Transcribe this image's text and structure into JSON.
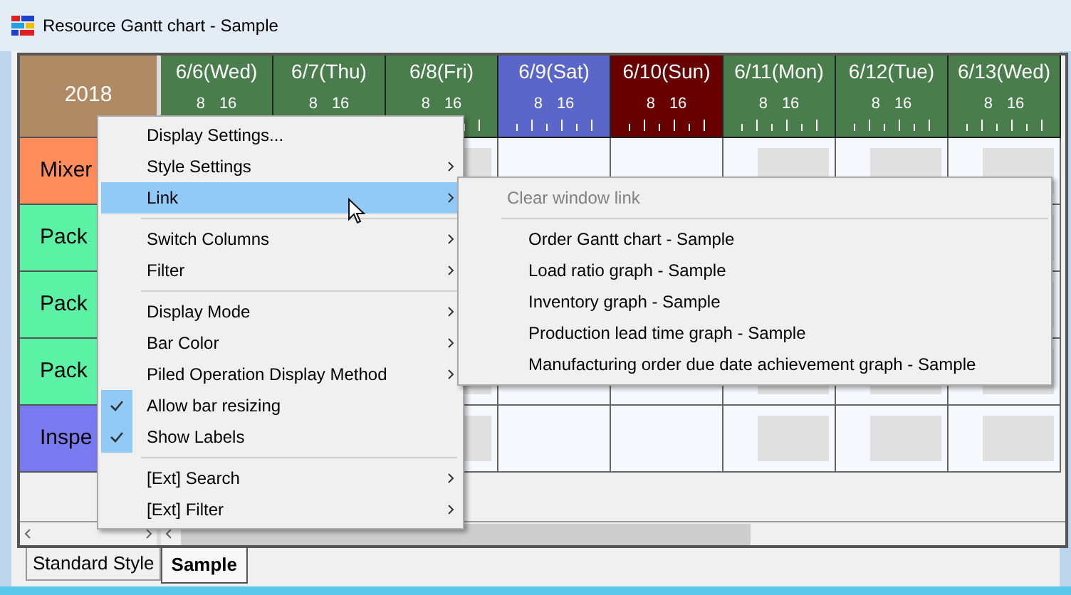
{
  "window": {
    "title": "Resource Gantt chart - Sample"
  },
  "year": "2018",
  "days": [
    {
      "label": "6/6(Wed)",
      "hours": [
        "8",
        "16"
      ],
      "kind": "weekday"
    },
    {
      "label": "6/7(Thu)",
      "hours": [
        "8",
        "16"
      ],
      "kind": "weekday"
    },
    {
      "label": "6/8(Fri)",
      "hours": [
        "8",
        "16"
      ],
      "kind": "weekday"
    },
    {
      "label": "6/9(Sat)",
      "hours": [
        "8",
        "16"
      ],
      "kind": "saturday"
    },
    {
      "label": "6/10(Sun)",
      "hours": [
        "8",
        "16"
      ],
      "kind": "sunday"
    },
    {
      "label": "6/11(Mon)",
      "hours": [
        "8",
        "16"
      ],
      "kind": "weekday"
    },
    {
      "label": "6/12(Tue)",
      "hours": [
        "8",
        "16"
      ],
      "kind": "weekday"
    },
    {
      "label": "6/13(Wed)",
      "hours": [
        "8",
        "16"
      ],
      "kind": "weekday"
    }
  ],
  "resources": [
    {
      "name": "Mixer",
      "color": "#ff8c5a"
    },
    {
      "name": "Pack",
      "color": "#5cf2a6"
    },
    {
      "name": "Pack",
      "color": "#5cf2a6"
    },
    {
      "name": "Pack",
      "color": "#5cf2a6"
    },
    {
      "name": "Inspe",
      "color": "#7a7af0"
    }
  ],
  "context_menu": {
    "items": [
      {
        "kind": "item",
        "label": "Display Settings...",
        "submenu": false,
        "checked": false,
        "selected": false
      },
      {
        "kind": "item",
        "label": "Style Settings",
        "submenu": true,
        "checked": false,
        "selected": false
      },
      {
        "kind": "item",
        "label": "Link",
        "submenu": true,
        "checked": false,
        "selected": true
      },
      {
        "kind": "separator"
      },
      {
        "kind": "item",
        "label": "Switch Columns",
        "submenu": true,
        "checked": false,
        "selected": false
      },
      {
        "kind": "item",
        "label": "Filter",
        "submenu": true,
        "checked": false,
        "selected": false
      },
      {
        "kind": "separator"
      },
      {
        "kind": "item",
        "label": "Display Mode",
        "submenu": true,
        "checked": false,
        "selected": false
      },
      {
        "kind": "item",
        "label": "Bar Color",
        "submenu": true,
        "checked": false,
        "selected": false
      },
      {
        "kind": "item",
        "label": "Piled Operation Display Method",
        "submenu": true,
        "checked": false,
        "selected": false
      },
      {
        "kind": "item",
        "label": "Allow bar resizing",
        "submenu": false,
        "checked": true,
        "selected": false
      },
      {
        "kind": "item",
        "label": "Show Labels",
        "submenu": false,
        "checked": true,
        "selected": false
      },
      {
        "kind": "separator"
      },
      {
        "kind": "item",
        "label": "[Ext] Search",
        "submenu": true,
        "checked": false,
        "selected": false
      },
      {
        "kind": "item",
        "label": "[Ext] Filter",
        "submenu": true,
        "checked": false,
        "selected": false
      }
    ]
  },
  "submenu": {
    "items": [
      {
        "kind": "item",
        "label": "Clear window link",
        "disabled": true
      },
      {
        "kind": "separator"
      },
      {
        "kind": "item",
        "label": "Order Gantt chart - Sample",
        "disabled": false
      },
      {
        "kind": "item",
        "label": "Load ratio graph - Sample",
        "disabled": false
      },
      {
        "kind": "item",
        "label": "Inventory graph - Sample",
        "disabled": false
      },
      {
        "kind": "item",
        "label": "Production lead time graph - Sample",
        "disabled": false
      },
      {
        "kind": "item",
        "label": "Manufacturing order due date achievement graph - Sample",
        "disabled": false
      }
    ]
  },
  "tabs": [
    {
      "label": "Standard Style",
      "selected": false
    },
    {
      "label": "Sample",
      "selected": true
    }
  ]
}
